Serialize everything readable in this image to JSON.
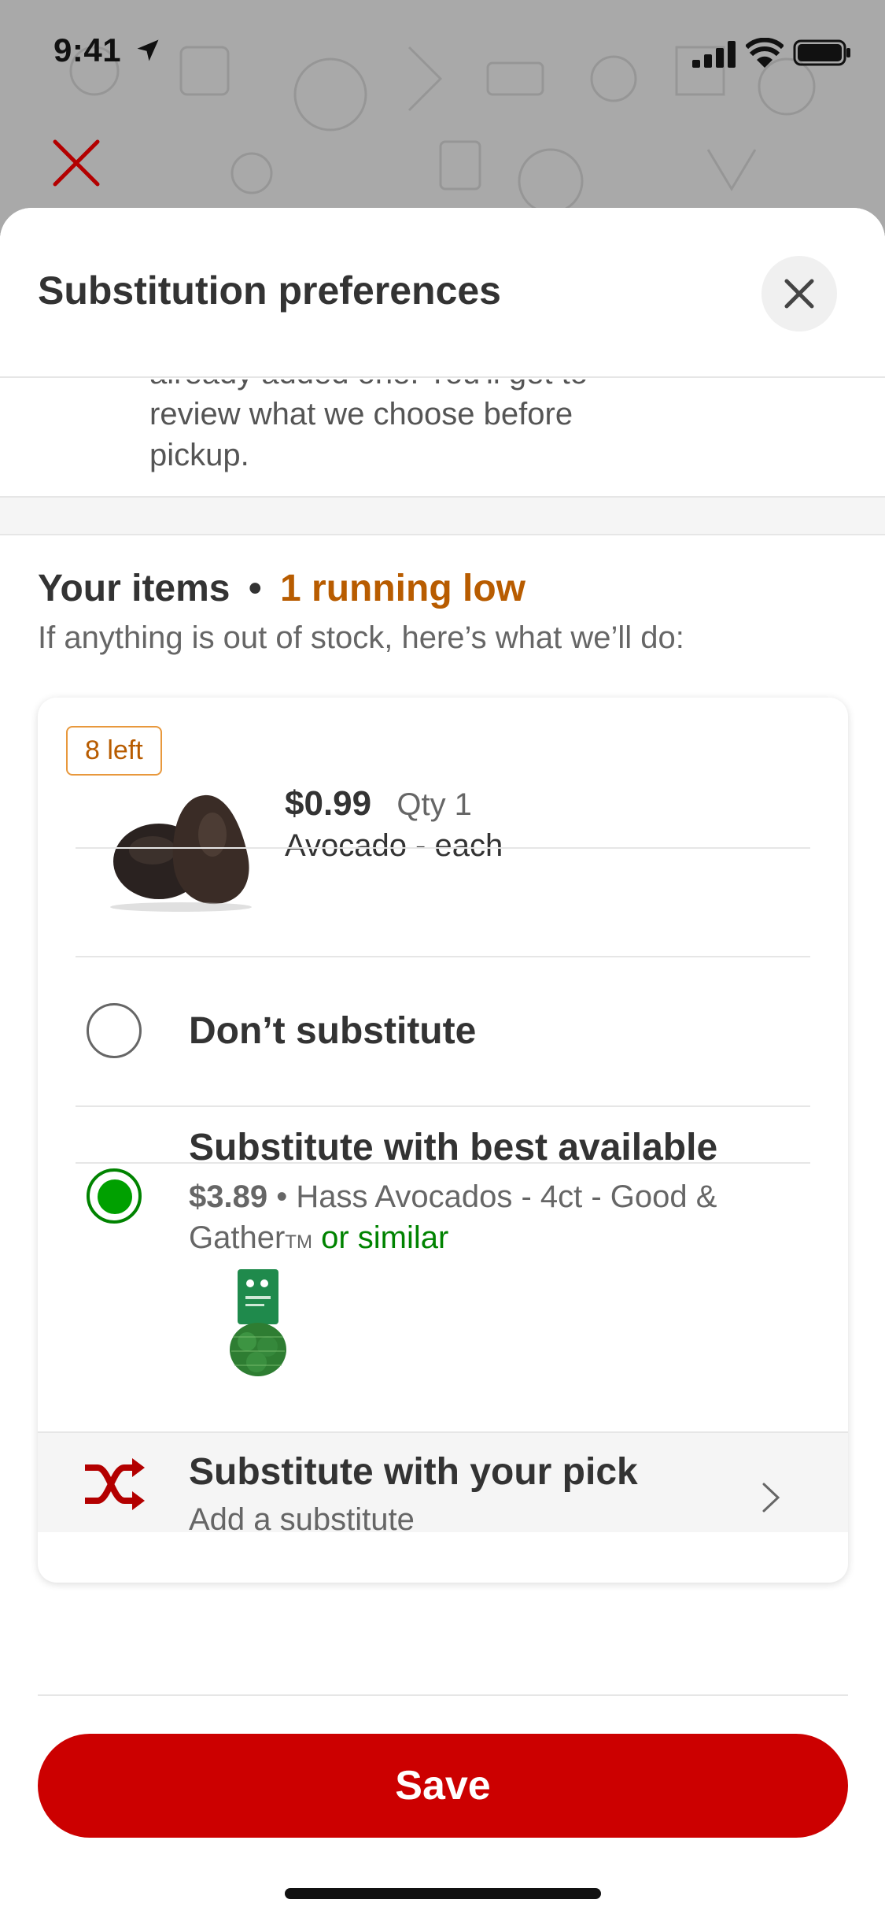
{
  "status_bar": {
    "time": "9:41",
    "icons": [
      "location-arrow-icon",
      "cellular-signal-icon",
      "wifi-icon",
      "battery-icon"
    ]
  },
  "backdrop": {
    "close_icon": "close-icon"
  },
  "sheet": {
    "title": "Substitution preferences",
    "close_icon": "close-icon",
    "intro_cut": "already added one. You'll get to",
    "intro_lines": [
      "review what we choose before",
      "pickup."
    ]
  },
  "items": {
    "heading": "Your items",
    "separator": "•",
    "low_count": "1 running low",
    "subheading": "If anything is out of stock, here’s what we’ll do:"
  },
  "product": {
    "badge": "8 left",
    "price": "$0.99",
    "qty": "Qty 1",
    "name": "Avocado - each",
    "image_icon": "avocado-image"
  },
  "options": {
    "dont_substitute": {
      "label": "Don’t substitute",
      "selected": false
    },
    "best_available": {
      "label": "Substitute with best available",
      "selected": true,
      "price": "$3.89",
      "separator": "•",
      "product": "Hass Avocados - 4ct - Good & Gather",
      "trademark": "TM",
      "similar": "or similar"
    },
    "your_pick": {
      "label": "Substitute with your pick",
      "sub": "Add a substitute",
      "icon": "shuffle-icon"
    }
  },
  "footer": {
    "save_label": "Save"
  },
  "colors": {
    "brand_red": "#cc0000",
    "selected_green": "#00a000",
    "warning_orange": "#b85c00"
  }
}
